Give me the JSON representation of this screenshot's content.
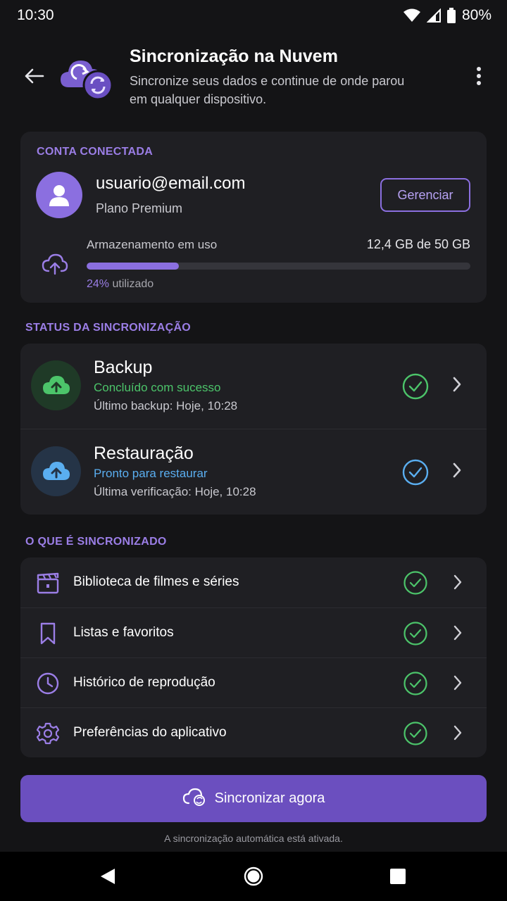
{
  "status_bar": {
    "time": "10:30",
    "battery": "80%"
  },
  "header": {
    "title": "Sincronização na Nuvem",
    "subtitle": "Sincronize seus dados e continue de onde parou em qualquer dispositivo."
  },
  "account": {
    "section_label": "CONTA CONECTADA",
    "email": "usuario@email.com",
    "plan": "Plano Premium",
    "manage_label": "Gerenciar",
    "storage_label": "Armazenamento em uso",
    "storage_value": "12,4 GB de 50 GB",
    "usage_percent_text": "24%",
    "usage_suffix": " utilizado",
    "usage_fraction": 0.24
  },
  "status_section": {
    "label": "STATUS DA SINCRONIZAÇÃO",
    "items": [
      {
        "title": "Backup",
        "state": "Concluído com sucesso",
        "meta": "Último backup: Hoje, 10:28",
        "color": "#4cc46a"
      },
      {
        "title": "Restauração",
        "state": "Pronto para restaurar",
        "meta": "Última verificação: Hoje, 10:28",
        "color": "#5aaef0"
      }
    ]
  },
  "sync_section": {
    "label": "O QUE É SINCRONIZADO",
    "items": [
      {
        "label": "Biblioteca de filmes e séries",
        "icon": "clapperboard-icon"
      },
      {
        "label": "Listas e favoritos",
        "icon": "bookmark-icon"
      },
      {
        "label": "Histórico de reprodução",
        "icon": "clock-icon"
      },
      {
        "label": "Preferências do aplicativo",
        "icon": "gear-icon"
      }
    ]
  },
  "sync_button_label": "Sincronizar agora",
  "auto_sync_note": "A sincronização automática está ativada.",
  "colors": {
    "accent": "#8b6fe0",
    "success": "#4cc46a",
    "info": "#5aaef0",
    "background": "#141416",
    "card": "#1f1f23"
  }
}
